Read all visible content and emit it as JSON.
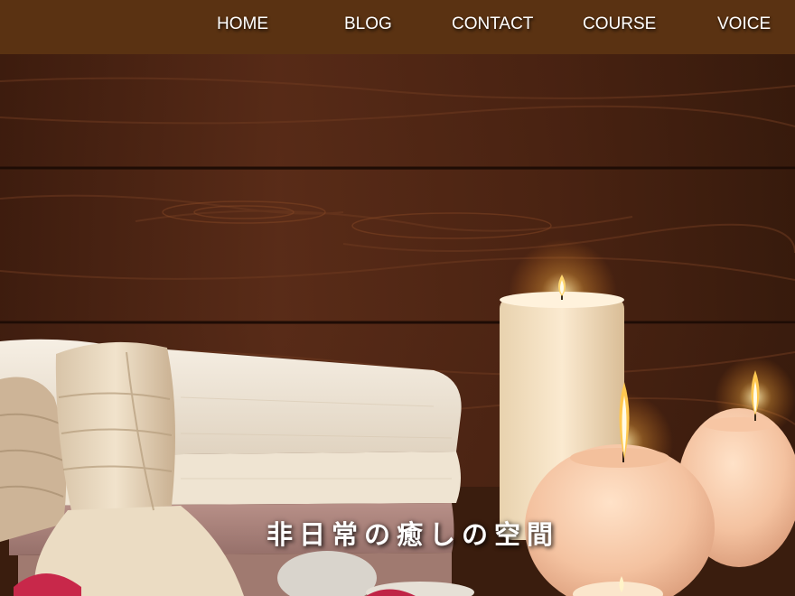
{
  "nav": {
    "items": [
      {
        "label": "HOME"
      },
      {
        "label": "BLOG"
      },
      {
        "label": "CONTACT"
      },
      {
        "label": "COURSE"
      },
      {
        "label": "VOICE"
      }
    ]
  },
  "hero": {
    "tagline": "非日常の癒しの空間",
    "image": "spa-candles-towels-photo"
  },
  "colors": {
    "nav_bg": "#5a3212",
    "nav_text": "#ffffff",
    "wood": "#4a2414"
  }
}
